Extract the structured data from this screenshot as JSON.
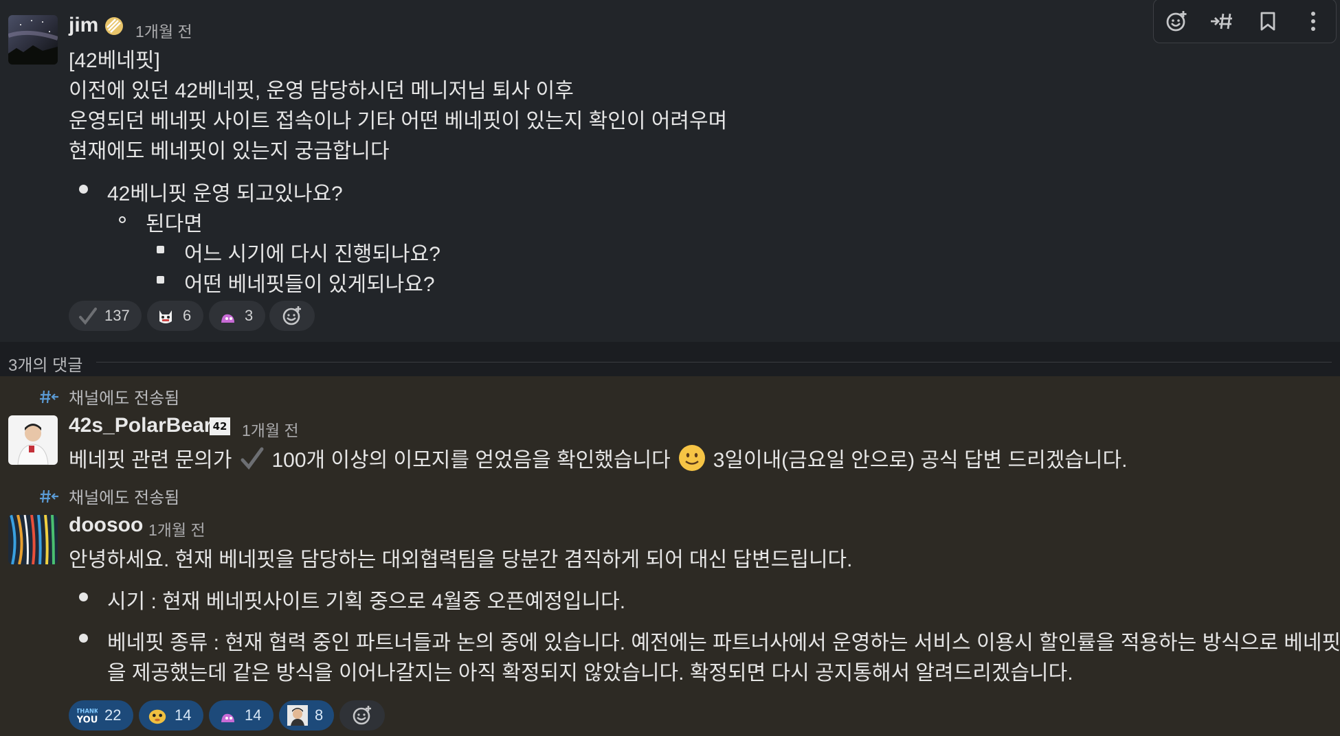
{
  "parent": {
    "author": "jim",
    "time": "1개월 전",
    "lines": [
      "[42베네핏]",
      "이전에 있던 42베네핏, 운영 담당하시던 메니저님 퇴사 이후",
      "운영되던 베네핏 사이트 접속이나 기타 어떤 베네핏이 있는지 확인이 어려우며",
      "현재에도 베네핏이 있는지 궁금합니다"
    ],
    "bullets": [
      {
        "level": 1,
        "text": "42베니핏 운영 되고있나요?"
      },
      {
        "level": 2,
        "text": "된다면"
      },
      {
        "level": 3,
        "text": "어느 시기에 다시 진행되나요?"
      },
      {
        "level": 3,
        "text": "어떤 베네핏들이 있게되나요?"
      }
    ],
    "reactions": [
      {
        "icon": "check-mark-icon",
        "count": "137"
      },
      {
        "icon": "cat-face-icon",
        "count": "6"
      },
      {
        "icon": "pink-blob-icon",
        "count": "3"
      }
    ]
  },
  "toolbar": {
    "items": [
      "add-reaction-icon",
      "forward-to-channel-icon",
      "bookmark-icon",
      "more-options-icon"
    ]
  },
  "divider": {
    "label": "3개의 댓글"
  },
  "replies": [
    {
      "sent_note": "채널에도 전송됨",
      "author": "42s_PolarBear",
      "badge": "42",
      "time": "1개월 전",
      "text_a": "베네핏 관련 문의가",
      "text_b": "100개 이상의 이모지를 얻었음을 확인했습니다",
      "text_c": "3일이내(금요일 안으로) 공식 답변 드리겠습니다."
    },
    {
      "sent_note": "채널에도 전송됨",
      "author": "doosoo",
      "time": "1개월 전",
      "intro": "안녕하세요. 현재 베네핏을 담당하는 대외협력팀을 당분간 겸직하게 되어 대신 답변드립니다.",
      "bullets": [
        "시기 : 현재 베네핏사이트 기획 중으로  4월중 오픈예정입니다.",
        "베네핏 종류 : 현재 협력 중인 파트너들과 논의 중에 있습니다. 예전에는 파트너사에서 운영하는 서비스 이용시 할인률을 적용하는 방식으로 베네핏",
        "을 제공했는데 같은 방식을 이어나갈지는 아직 확정되지 않았습니다. 확정되면 다시 공지통해서 알려드리겠습니다."
      ],
      "reactions": [
        {
          "icon": "thank-you-icon",
          "count": "22"
        },
        {
          "icon": "yellow-face-icon",
          "count": "14"
        },
        {
          "icon": "pink-blob-icon",
          "count": "14"
        },
        {
          "icon": "person-photo-icon",
          "count": "8"
        }
      ]
    }
  ],
  "colors": {
    "reaction_highlight": "#1d4a7a",
    "parent_bg": "#222529",
    "thread_bg": "#2d2a24"
  }
}
